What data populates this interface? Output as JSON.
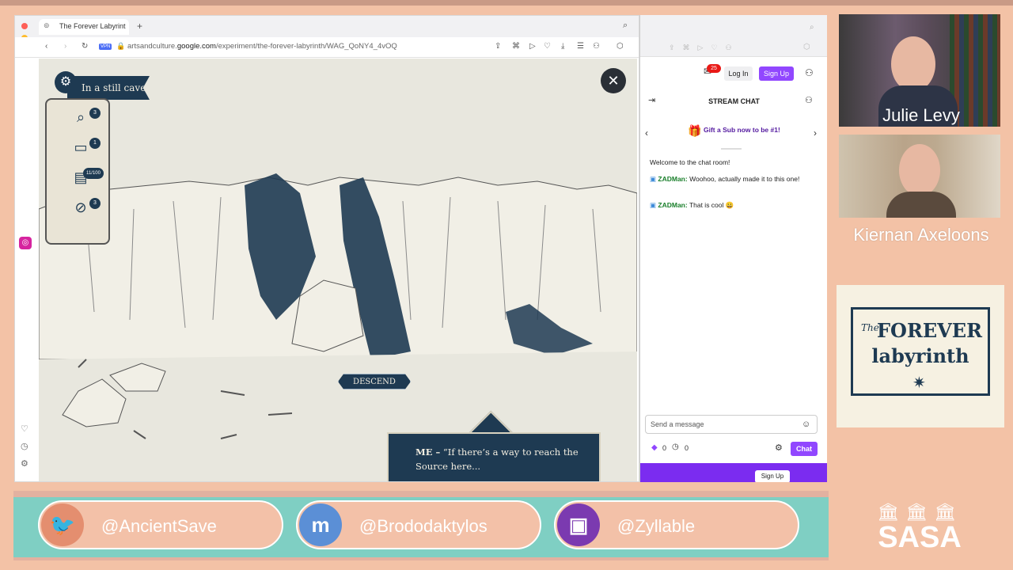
{
  "browser": {
    "tab_title": "The Forever Labyrint",
    "url_prefix": "artsandculture.",
    "url_domain": "google.com",
    "url_path": "/experiment/the-forever-labyrinth/WAG_QoNY4_4vOQ",
    "vpn_label": "VPN"
  },
  "game": {
    "location": "In a still cave",
    "inventory": [
      {
        "icon": "magnifier-icon",
        "count": "3"
      },
      {
        "icon": "chest-icon",
        "count": "1"
      },
      {
        "icon": "page-icon",
        "count": "11/100"
      },
      {
        "icon": "compass-icon",
        "count": "3"
      }
    ],
    "descend_label": "DESCEND",
    "dialog_speaker": "ME –",
    "dialog_text": "“If there’s a way to reach the Source here..."
  },
  "chat": {
    "notif_count": "25",
    "login_label": "Log In",
    "signup_label": "Sign Up",
    "title": "STREAM CHAT",
    "gift_text": "Gift a Sub now to be #1!",
    "welcome": "Welcome to the chat room!",
    "messages": [
      {
        "user": "ZADMan:",
        "text": "Woohoo, actually made it to this one!"
      },
      {
        "user": "ZADMan:",
        "text": "That is cool 😀"
      }
    ],
    "input_placeholder": "Send a message",
    "points_a": "0",
    "points_b": "0",
    "send_label": "Chat",
    "bottom_label": "Sign Up"
  },
  "webcams": {
    "name1": "Julie Levy",
    "name2": "Kiernan Axeloons"
  },
  "logo": {
    "the": "The",
    "forever": "FOREVER",
    "labyrinth": "labyrinth"
  },
  "socials": [
    {
      "icon": "twitter-icon",
      "handle": "@AncientSave",
      "color": "#e48e6f"
    },
    {
      "icon": "mastodon-icon",
      "handle": "@Brododaktylos",
      "color": "#5b8fd6"
    },
    {
      "icon": "twitch-icon",
      "handle": "@Zyllable",
      "color": "#7b3ab0"
    }
  ],
  "brand": {
    "sasa": "SASA"
  }
}
